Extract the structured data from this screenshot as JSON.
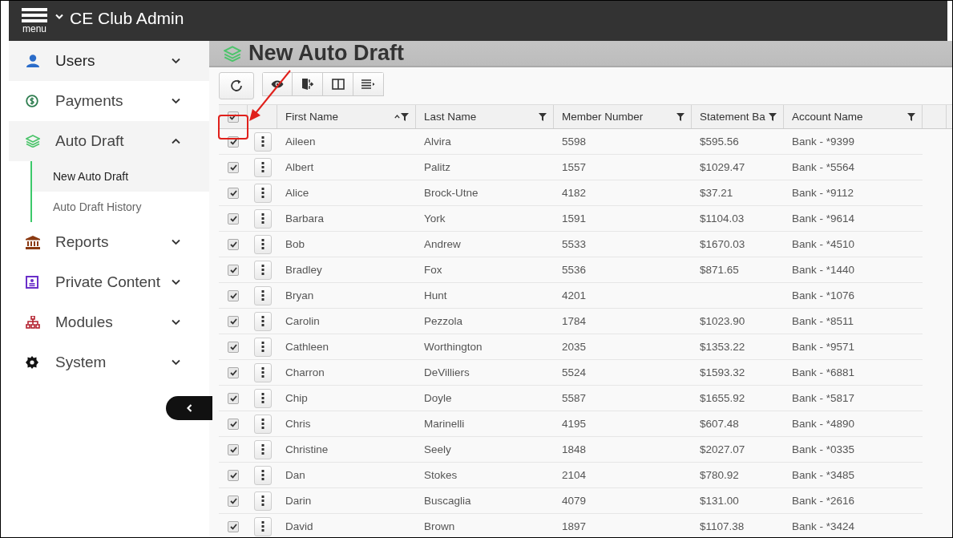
{
  "app": {
    "menu_label": "menu",
    "title": "CE Club Admin"
  },
  "sidebar": {
    "items": [
      {
        "label": "Users",
        "expanded": false
      },
      {
        "label": "Payments",
        "expanded": false
      },
      {
        "label": "Auto Draft",
        "expanded": true,
        "children": [
          {
            "label": "New Auto Draft",
            "selected": true
          },
          {
            "label": "Auto Draft History",
            "selected": false
          }
        ]
      },
      {
        "label": "Reports",
        "expanded": false
      },
      {
        "label": "Private Content",
        "expanded": false
      },
      {
        "label": "Modules",
        "expanded": false
      },
      {
        "label": "System",
        "expanded": false
      }
    ]
  },
  "page": {
    "title": "New Auto Draft"
  },
  "table": {
    "select_all_checked": true,
    "columns": [
      {
        "label": "First Name",
        "sorted": true
      },
      {
        "label": "Last Name",
        "sorted": false
      },
      {
        "label": "Member Number",
        "sorted": false
      },
      {
        "label": "Statement Ba",
        "sorted": false
      },
      {
        "label": "Account Name",
        "sorted": false
      }
    ],
    "rows": [
      {
        "checked": true,
        "cells": [
          "Aileen",
          "Alvira",
          "5598",
          "$595.56",
          "Bank - *9399"
        ]
      },
      {
        "checked": true,
        "cells": [
          "Albert",
          "Palitz",
          "1557",
          "$1029.47",
          "Bank - *5564"
        ]
      },
      {
        "checked": true,
        "cells": [
          "Alice",
          "Brock-Utne",
          "4182",
          "$37.21",
          "Bank - *9112"
        ]
      },
      {
        "checked": true,
        "cells": [
          "Barbara",
          "York",
          "1591",
          "$1104.03",
          "Bank - *9614"
        ]
      },
      {
        "checked": true,
        "cells": [
          "Bob",
          "Andrew",
          "5533",
          "$1670.03",
          "Bank - *4510"
        ]
      },
      {
        "checked": true,
        "cells": [
          "Bradley",
          "Fox",
          "5536",
          "$871.65",
          "Bank - *1440"
        ]
      },
      {
        "checked": true,
        "cells": [
          "Bryan",
          "Hunt",
          "4201",
          "",
          "Bank - *1076"
        ]
      },
      {
        "checked": true,
        "cells": [
          "Carolin",
          "Pezzola",
          "1784",
          "$1023.90",
          "Bank - *8511"
        ]
      },
      {
        "checked": true,
        "cells": [
          "Cathleen",
          "Worthington",
          "2035",
          "$1353.22",
          "Bank - *9571"
        ]
      },
      {
        "checked": true,
        "cells": [
          "Charron",
          "DeVilliers",
          "5524",
          "$1593.32",
          "Bank - *6881"
        ]
      },
      {
        "checked": true,
        "cells": [
          "Chip",
          "Doyle",
          "5587",
          "$1655.92",
          "Bank - *5817"
        ]
      },
      {
        "checked": true,
        "cells": [
          "Chris",
          "Marinelli",
          "4195",
          "$607.48",
          "Bank - *4890"
        ]
      },
      {
        "checked": true,
        "cells": [
          "Christine",
          "Seely",
          "1848",
          "$2027.07",
          "Bank - *0335"
        ]
      },
      {
        "checked": true,
        "cells": [
          "Dan",
          "Stokes",
          "2104",
          "$780.92",
          "Bank - *3485"
        ]
      },
      {
        "checked": true,
        "cells": [
          "Darin",
          "Buscaglia",
          "4079",
          "$131.00",
          "Bank - *2616"
        ]
      },
      {
        "checked": true,
        "cells": [
          "David",
          "Brown",
          "1897",
          "$1107.38",
          "Bank - *3424"
        ]
      }
    ]
  }
}
